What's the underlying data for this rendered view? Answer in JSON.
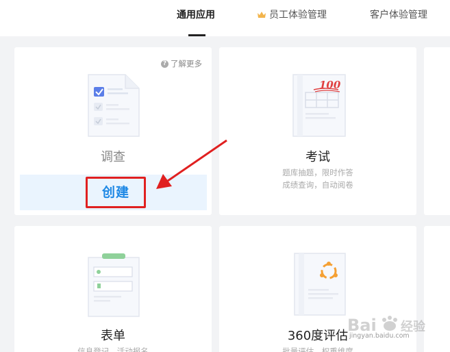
{
  "tabs": [
    {
      "label": "通用应用",
      "active": true
    },
    {
      "label": "员工体验管理",
      "icon": "crown-icon"
    },
    {
      "label": "客户体验管理"
    }
  ],
  "cards": {
    "survey": {
      "title": "调查",
      "learn_more": "了解更多",
      "create_label": "创建"
    },
    "exam": {
      "title": "考试",
      "desc_line1": "题库抽题，限时作答",
      "desc_line2": "成绩查询，自动阅卷",
      "score_mark": "100"
    },
    "form": {
      "title": "表单",
      "desc_line1": "信息登记，活动报名"
    },
    "eval360": {
      "title": "360度评估",
      "desc_line1": "批量评估，权重维度"
    }
  },
  "watermark": {
    "text": "Bai",
    "text2": "经验",
    "url": "jingyan.baidu.com"
  },
  "colors": {
    "accent_blue": "#1e88e5",
    "highlight_red": "#e02020",
    "strip_bg": "#eaf4fe",
    "score_red": "#e04040",
    "eval_orange": "#f5a033",
    "form_green": "#66bb6a"
  }
}
